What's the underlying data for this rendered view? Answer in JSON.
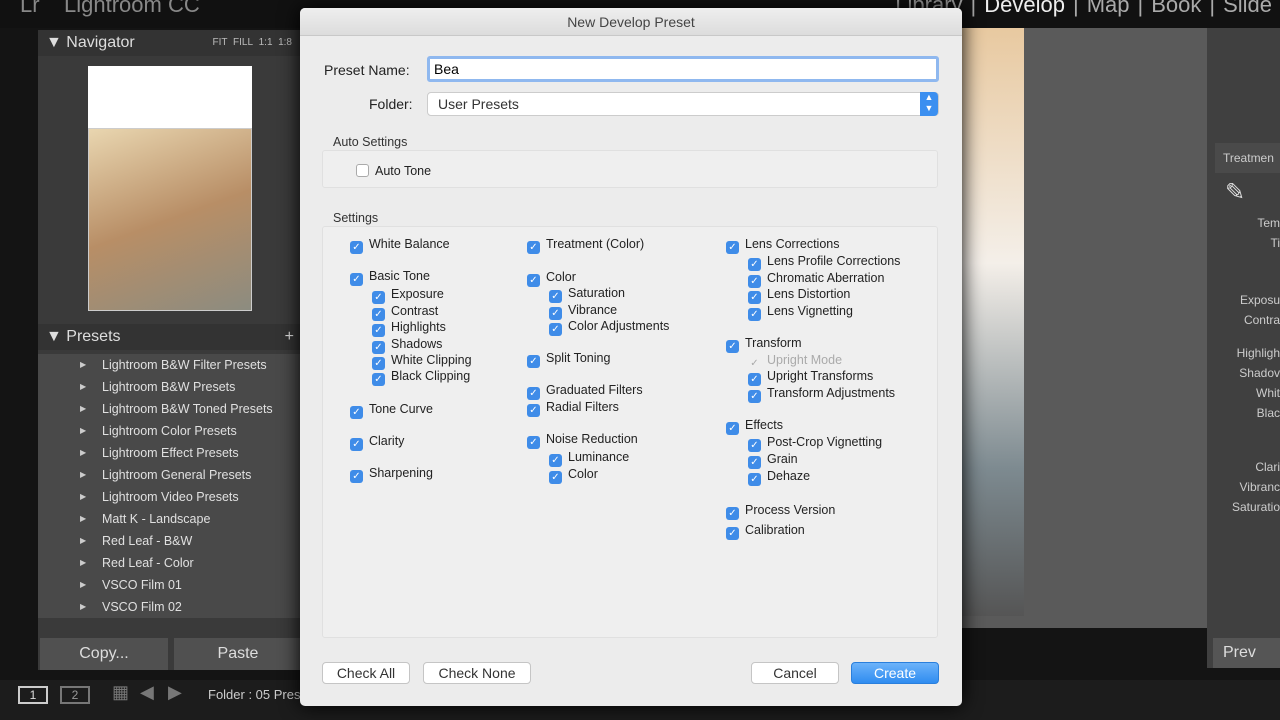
{
  "app": {
    "logo": "Lr",
    "title": "Lightroom CC",
    "modules": [
      "Library",
      "Develop",
      "Map",
      "Book",
      "Slide"
    ],
    "active_module": "Develop"
  },
  "navigator": {
    "title": "Navigator",
    "options": [
      "FIT",
      "FILL",
      "1:1",
      "1:8"
    ]
  },
  "presets": {
    "title": "Presets",
    "add": "+",
    "items": [
      "Lightroom B&W Filter Presets",
      "Lightroom B&W Presets",
      "Lightroom B&W Toned Presets",
      "Lightroom Color Presets",
      "Lightroom Effect Presets",
      "Lightroom General Presets",
      "Lightroom Video Presets",
      "Matt K - Landscape",
      "Red Leaf - B&W",
      "Red Leaf - Color",
      "VSCO Film 01",
      "VSCO Film 02"
    ]
  },
  "left_buttons": {
    "copy": "Copy...",
    "paste": "Paste"
  },
  "toolbar": {
    "screen1": "1",
    "screen2": "2",
    "folder": "Folder : 05 Pres"
  },
  "right_panel": {
    "header": "Treatmen",
    "labels": [
      "Tem",
      "Ti",
      "Exposu",
      "Contra",
      "Highligh",
      "Shadov",
      "Whit",
      "Blac",
      "Clari",
      "Vibranc",
      "Saturatio"
    ],
    "prev": "Prev"
  },
  "dialog": {
    "title": "New Develop Preset",
    "preset_name_label": "Preset Name:",
    "preset_name_value": "Bea",
    "folder_label": "Folder:",
    "folder_value": "User Presets",
    "auto_settings_label": "Auto Settings",
    "auto_tone": {
      "label": "Auto Tone",
      "checked": false
    },
    "settings_label": "Settings",
    "columns": [
      [
        {
          "label": "White Balance",
          "checked": true
        },
        {
          "label": "Basic Tone",
          "checked": true
        },
        {
          "label": "Exposure",
          "checked": true,
          "sub": true
        },
        {
          "label": "Contrast",
          "checked": true,
          "sub": true
        },
        {
          "label": "Highlights",
          "checked": true,
          "sub": true
        },
        {
          "label": "Shadows",
          "checked": true,
          "sub": true
        },
        {
          "label": "White Clipping",
          "checked": true,
          "sub": true
        },
        {
          "label": "Black Clipping",
          "checked": true,
          "sub": true
        },
        {
          "label": "Tone Curve",
          "checked": true
        },
        {
          "label": "Clarity",
          "checked": true
        },
        {
          "label": "Sharpening",
          "checked": true
        }
      ],
      [
        {
          "label": "Treatment (Color)",
          "checked": true
        },
        {
          "label": "Color",
          "checked": true
        },
        {
          "label": "Saturation",
          "checked": true,
          "sub": true
        },
        {
          "label": "Vibrance",
          "checked": true,
          "sub": true
        },
        {
          "label": "Color Adjustments",
          "checked": true,
          "sub": true
        },
        {
          "label": "Split Toning",
          "checked": true
        },
        {
          "label": "Graduated Filters",
          "checked": true
        },
        {
          "label": "Radial Filters",
          "checked": true
        },
        {
          "label": "Noise Reduction",
          "checked": true
        },
        {
          "label": "Luminance",
          "checked": true,
          "sub": true
        },
        {
          "label": "Color",
          "checked": true,
          "sub": true
        }
      ],
      [
        {
          "label": "Lens Corrections",
          "checked": true
        },
        {
          "label": "Lens Profile Corrections",
          "checked": true,
          "sub": true
        },
        {
          "label": "Chromatic Aberration",
          "checked": true,
          "sub": true
        },
        {
          "label": "Lens Distortion",
          "checked": true,
          "sub": true
        },
        {
          "label": "Lens Vignetting",
          "checked": true,
          "sub": true
        },
        {
          "label": "Transform",
          "checked": true
        },
        {
          "label": "Upright Mode",
          "checked": true,
          "sub": true,
          "disabled": true
        },
        {
          "label": "Upright Transforms",
          "checked": true,
          "sub": true
        },
        {
          "label": "Transform Adjustments",
          "checked": true,
          "sub": true
        },
        {
          "label": "Effects",
          "checked": true
        },
        {
          "label": "Post-Crop Vignetting",
          "checked": true,
          "sub": true
        },
        {
          "label": "Grain",
          "checked": true,
          "sub": true
        },
        {
          "label": "Dehaze",
          "checked": true,
          "sub": true
        },
        {
          "label": "Process Version",
          "checked": true
        },
        {
          "label": "Calibration",
          "checked": true
        }
      ]
    ],
    "buttons": {
      "check_all": "Check All",
      "check_none": "Check None",
      "cancel": "Cancel",
      "create": "Create"
    }
  },
  "colors": {
    "accent": "#3f8ce8",
    "dialog_bg": "#ececec"
  }
}
